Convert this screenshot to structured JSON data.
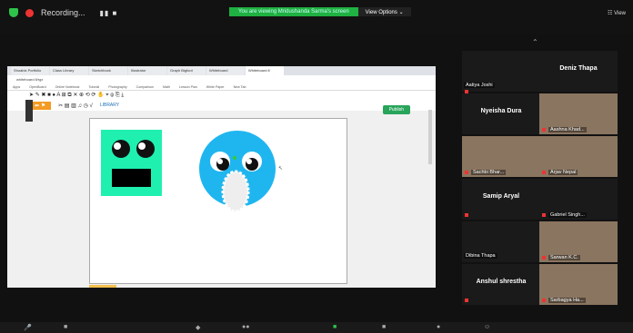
{
  "topbar": {
    "recording_label": "Recording...",
    "controls": "▮▮ ■",
    "banner_text": "You are viewing Mridushanda Sarma's screen",
    "view_options": "View Options ⌄",
    "view_button": "☷ View"
  },
  "browser": {
    "tabs": [
      "Shoabiz Portfolio",
      "Class Library",
      "Sketchbook",
      "Illustrator",
      "Graph Bigfoot",
      "Whiteboard",
      "Whiteboard.fi"
    ],
    "address": "whiteboard.fi/rgx",
    "bookmarks": [
      "Apps",
      "OpenBoard",
      "Online Notebook",
      "Tutorial",
      "Photography",
      "Comparison",
      "Math",
      "Lesson Plan",
      "White Paper",
      "New Tab"
    ]
  },
  "toolbar": {
    "row1": "➤ ✎ ✖ ■ ● A ⊞ ⧉ ✕ ⊕ ⟲ ⟳ ✋ ⌖ ⊛ ⎘ ⤓",
    "row2_btn": "⬅ ⚑",
    "row2_icons": "✂ ▤ ▥ ♫ ◷ √",
    "library": "LIBRARY",
    "publish": "Publish"
  },
  "participants": [
    {
      "name": "Aatiya Joshi",
      "type": "label",
      "muted": true
    },
    {
      "name": "Deniz Thapa",
      "type": "name"
    },
    {
      "name": "Nyeisha Dura",
      "type": "name"
    },
    {
      "name": "Aashna Khad...",
      "type": "video",
      "muted": true
    },
    {
      "name": "Sachbi Bhar...",
      "type": "video",
      "muted": true
    },
    {
      "name": "Arjav Nepal",
      "type": "video",
      "muted": true
    },
    {
      "name": "Samip Aryal",
      "type": "name"
    },
    {
      "name": "Gabriel Singh...",
      "type": "label",
      "muted": true
    },
    {
      "name": "Dibina Thapa",
      "type": "label"
    },
    {
      "name": "Sarwan K.C.",
      "type": "video",
      "muted": true
    },
    {
      "name": "Anshul shrestha",
      "type": "name"
    },
    {
      "name": "Sarbagya Ha...",
      "type": "video",
      "muted": true
    }
  ],
  "colors": {
    "banner": "#1fb141",
    "robot_bg": "#1ff0b0",
    "owl_blue": "#1fb6f0",
    "mute_red": "#e33"
  }
}
